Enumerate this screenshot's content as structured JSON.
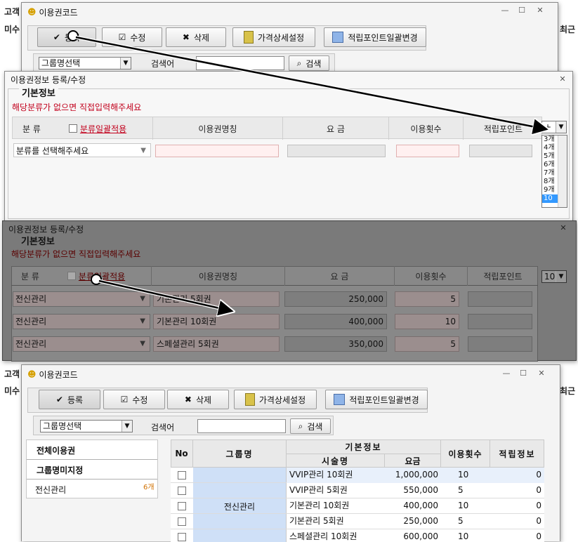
{
  "bg": {
    "frag_left_top": "고객",
    "frag_left_mid": "미수",
    "frag_right_top": "최근",
    "frag_right_mid": "최근",
    "frag_left_b1": "고객",
    "frag_left_b2": "미수",
    "frag_right_b2": "최근"
  },
  "win_top": {
    "title": "이용권코드",
    "toolbar": {
      "register": "등록",
      "edit": "수정",
      "delete": "삭제",
      "price_detail": "가격상세설정",
      "points_bulk": "적립포인트일괄변경"
    },
    "group_select": "그룹명선택",
    "search_label": "검색어",
    "search_button": "검색"
  },
  "form1": {
    "title": "이용권정보 등록/수정",
    "section": "기본정보",
    "warning": "해당분류가 없으면 직접입력해주세요",
    "headers": {
      "category": "분  류",
      "bulk_apply": "분류일괄적용",
      "name": "이용권명칭",
      "fee": "요  금",
      "count": "이용횟수",
      "points": "적립포인트"
    },
    "row": {
      "category": "분류를 선택해주세요"
    },
    "count_select": "+",
    "count_options": [
      "3개",
      "4개",
      "5개",
      "6개",
      "7개",
      "8개",
      "9개",
      "10"
    ]
  },
  "form2": {
    "title": "이용권정보 등록/수정",
    "section": "기본정보",
    "warning": "해당분류가 없으면 직접입력해주세요",
    "headers": {
      "category": "분  류",
      "bulk_apply": "분류일괄적용",
      "name": "이용권명칭",
      "fee": "요  금",
      "count": "이용횟수",
      "points": "적립포인트"
    },
    "count_select": "10",
    "rows": [
      {
        "category": "전신관리",
        "name": "기본관리 5회권",
        "fee": "250,000",
        "count": "5"
      },
      {
        "category": "전신관리",
        "name": "기본관리 10회권",
        "fee": "400,000",
        "count": "10"
      },
      {
        "category": "전신관리",
        "name": "스페셜관리 5회권",
        "fee": "350,000",
        "count": "5"
      }
    ]
  },
  "win_bottom": {
    "title": "이용권코드",
    "toolbar": {
      "register": "등록",
      "edit": "수정",
      "delete": "삭제",
      "price_detail": "가격상세설정",
      "points_bulk": "적립포인트일괄변경"
    },
    "group_select": "그룹명선택",
    "search_label": "검색어",
    "search_button": "검색",
    "groups": [
      {
        "label": "전체이용권",
        "bold": true
      },
      {
        "label": "그룹명미지정",
        "bold": true
      },
      {
        "label": "전신관리",
        "count": "6개"
      }
    ],
    "table": {
      "h_no": "No",
      "h_group": "그룹명",
      "h_basic": "기본정보",
      "h_name": "시술명",
      "h_fee": "요금",
      "h_count": "이용횟수",
      "h_points": "적립정보",
      "group_value": "전신관리",
      "rows": [
        {
          "name": "VVIP관리 10회권",
          "fee": "1,000,000",
          "count": "10",
          "points": "0"
        },
        {
          "name": "VVIP관리 5회권",
          "fee": "550,000",
          "count": "5",
          "points": "0"
        },
        {
          "name": "기본관리 10회권",
          "fee": "400,000",
          "count": "10",
          "points": "0"
        },
        {
          "name": "기본관리 5회권",
          "fee": "250,000",
          "count": "5",
          "points": "0"
        },
        {
          "name": "스페셜관리 10회권",
          "fee": "600,000",
          "count": "10",
          "points": "0"
        }
      ]
    }
  },
  "colors": {
    "accent_red": "#c2001c",
    "row_blue": "#e8f0fb",
    "group_cell": "#cfe0f7"
  }
}
